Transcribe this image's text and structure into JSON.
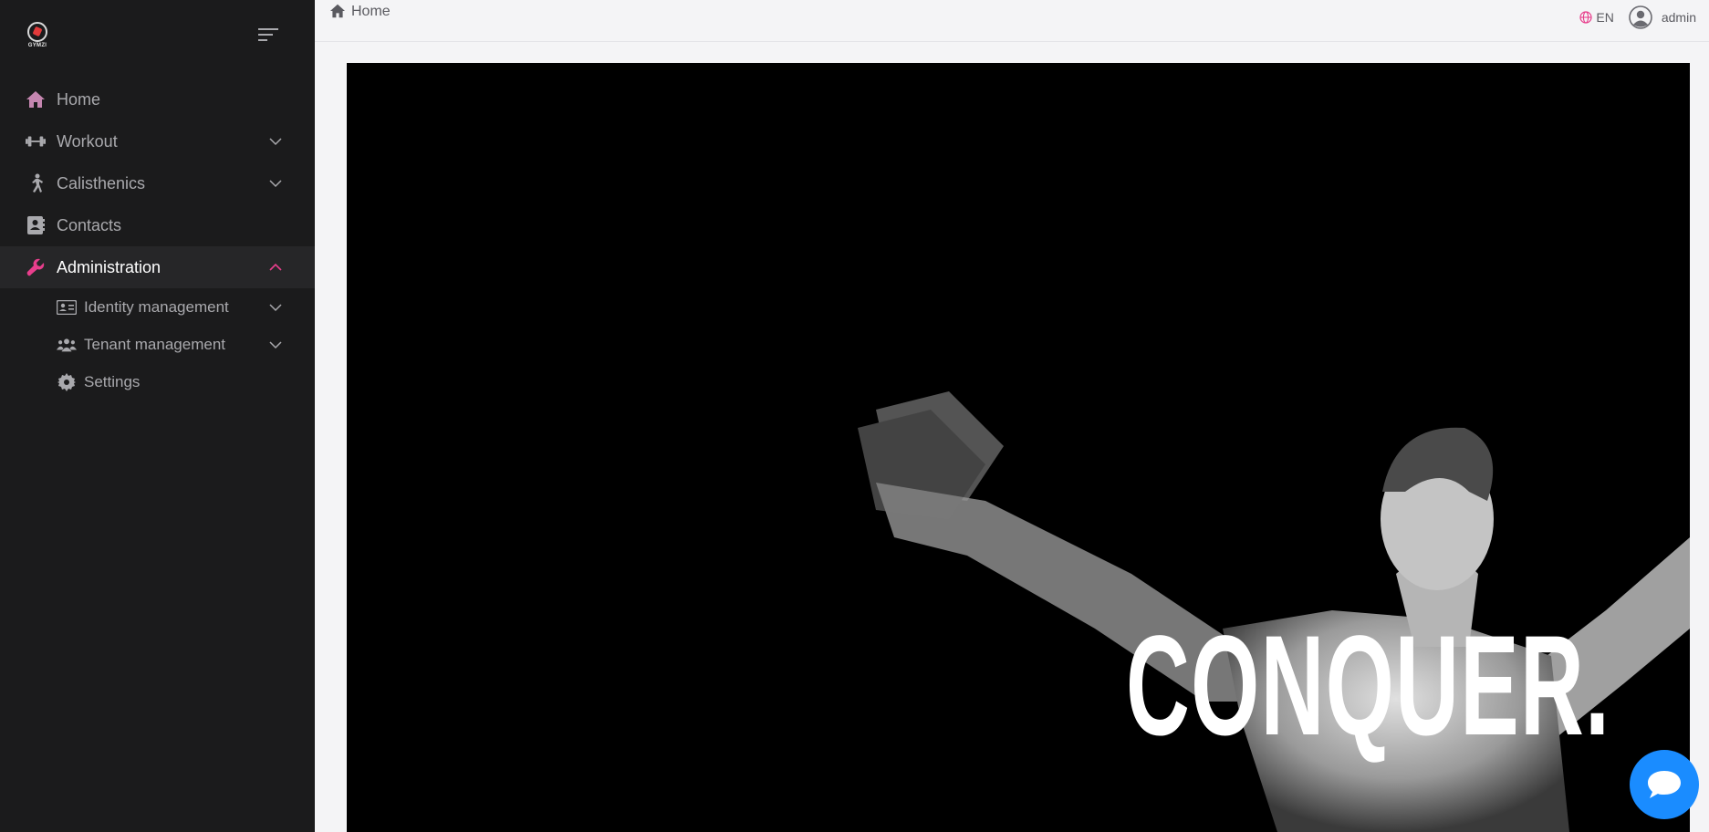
{
  "app": {
    "logo_text": "GYMZI"
  },
  "sidebar": {
    "items": [
      {
        "label": "Home",
        "icon": "home-icon",
        "icon_color": "#c586b0"
      },
      {
        "label": "Workout",
        "icon": "dumbbell-icon",
        "has_children": true
      },
      {
        "label": "Calisthenics",
        "icon": "running-icon",
        "has_children": true
      },
      {
        "label": "Contacts",
        "icon": "contact-book-icon"
      },
      {
        "label": "Administration",
        "icon": "wrench-icon",
        "active": true,
        "expanded": true,
        "icon_color": "#e83e8c"
      }
    ],
    "admin_children": [
      {
        "label": "Identity management",
        "icon": "id-card-icon",
        "has_children": true
      },
      {
        "label": "Tenant management",
        "icon": "users-icon",
        "has_children": true
      },
      {
        "label": "Settings",
        "icon": "gear-icon"
      }
    ]
  },
  "topbar": {
    "breadcrumb": "Home",
    "language": "EN",
    "username": "admin"
  },
  "banner": {
    "text": "CONQUER."
  },
  "colors": {
    "accent": "#e83e8c",
    "sidebar_bg": "#1b1b1c",
    "chat_button": "#1a8cff"
  }
}
